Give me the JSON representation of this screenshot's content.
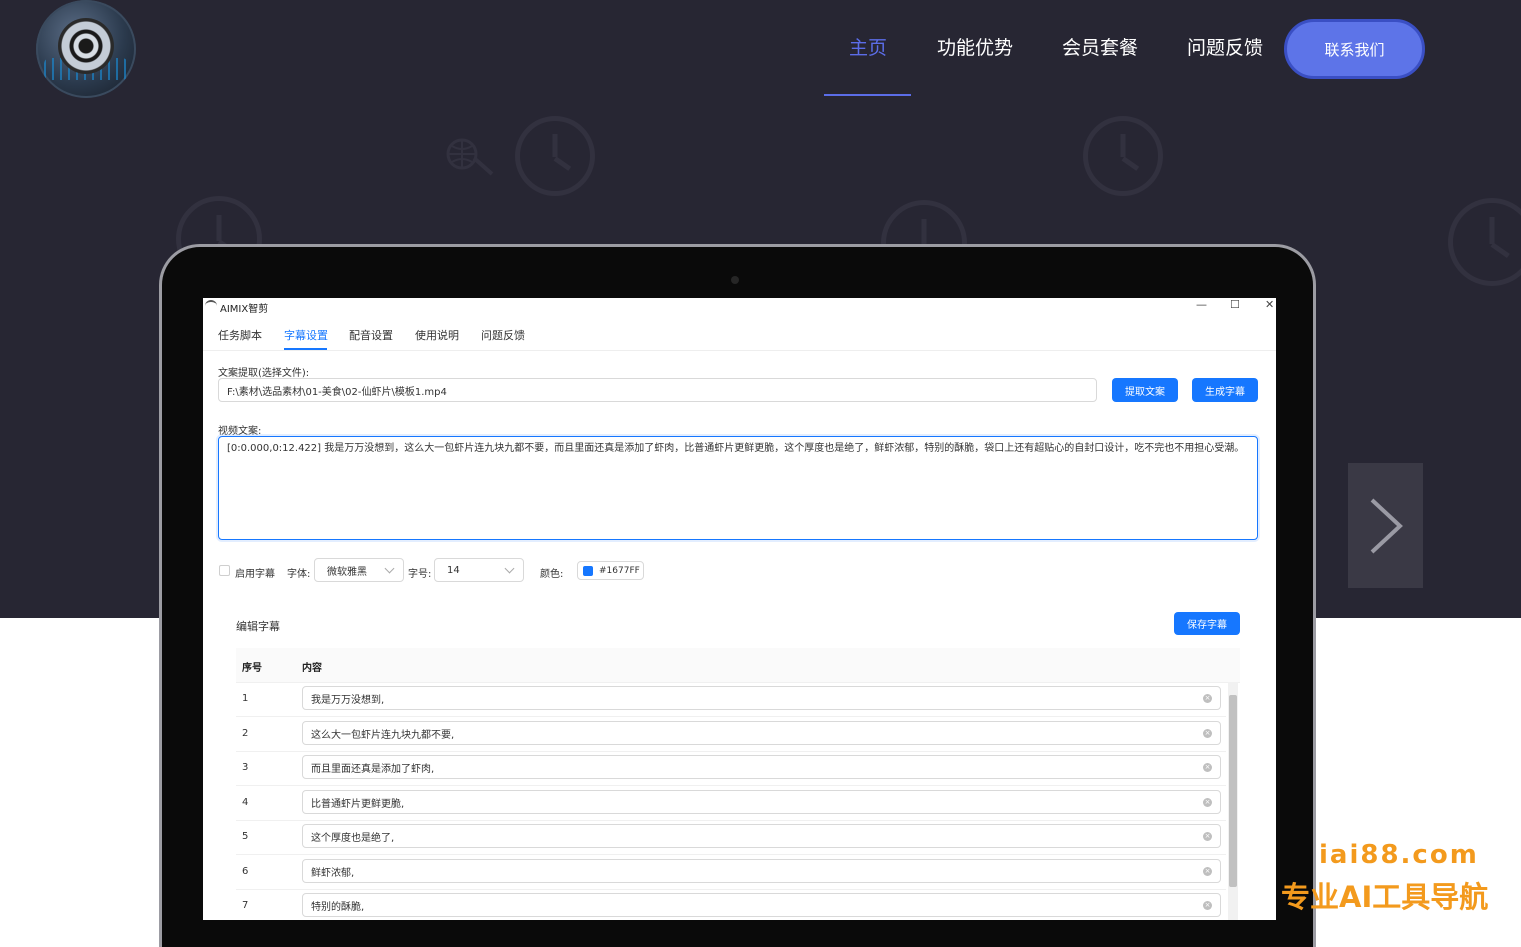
{
  "site": {
    "nav": [
      {
        "label": "主页",
        "active": true
      },
      {
        "label": "功能优势",
        "active": false
      },
      {
        "label": "会员套餐",
        "active": false
      },
      {
        "label": "问题反馈",
        "active": false
      }
    ],
    "contact_label": "联系我们"
  },
  "app": {
    "title": "AIMIX智剪",
    "window_controls": [
      "—",
      "☐",
      "✕"
    ],
    "tabs": [
      {
        "label": "任务脚本",
        "active": false
      },
      {
        "label": "字幕设置",
        "active": true
      },
      {
        "label": "配音设置",
        "active": false
      },
      {
        "label": "使用说明",
        "active": false
      },
      {
        "label": "问题反馈",
        "active": false
      }
    ],
    "file_label": "文案提取(选择文件):",
    "file_path": "F:\\素材\\选品素材\\01-美食\\02-仙虾片\\模板1.mp4",
    "extract_button": "提取文案",
    "generate_button": "生成字幕",
    "script_label": "视频文案:",
    "script_text": "[0:0.000,0:12.422]  我是万万没想到，这么大一包虾片连九块九都不要，而且里面还真是添加了虾肉，比普通虾片更鲜更脆，这个厚度也是绝了，鲜虾浓郁，特别的酥脆，袋口上还有超贴心的自封口设计，吃不完也不用担心受潮。",
    "enable_subtitle_label": "启用字幕",
    "font_label": "字体:",
    "font_value": "微软雅黑",
    "size_label": "字号:",
    "size_value": "14",
    "color_label": "颜色:",
    "color_value": "#1677FF",
    "edit_title": "编辑字幕",
    "save_button": "保存字幕",
    "table_headers": [
      "序号",
      "内容"
    ],
    "rows": [
      {
        "idx": "1",
        "text": "我是万万没想到,"
      },
      {
        "idx": "2",
        "text": "这么大一包虾片连九块九都不要,"
      },
      {
        "idx": "3",
        "text": "而且里面还真是添加了虾肉,"
      },
      {
        "idx": "4",
        "text": "比普通虾片更鲜更脆,"
      },
      {
        "idx": "5",
        "text": "这个厚度也是绝了,"
      },
      {
        "idx": "6",
        "text": "鲜虾浓郁,"
      },
      {
        "idx": "7",
        "text": "特别的酥脆,"
      }
    ]
  },
  "watermark": {
    "domain": "iai88.com",
    "slogan": "专业AI工具导航"
  },
  "colors": {
    "hero_bg": "#272633",
    "nav_active": "#5b6de8",
    "contact_button": "#5d74e8",
    "app_primary": "#1677ff",
    "watermark": "#f39a1d"
  }
}
